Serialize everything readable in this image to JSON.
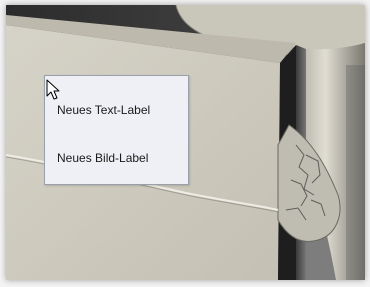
{
  "context_menu": {
    "items": [
      {
        "label": "Neues Text-Label"
      },
      {
        "label": "Neues Bild-Label"
      }
    ]
  },
  "icons": {
    "cursor": "arrow-cursor-icon"
  },
  "colors": {
    "menu_background": "#eef0f6",
    "menu_border": "#9aa0aa",
    "model_face": "#cfcbbf",
    "model_dark_edge": "#1f1f1f",
    "background": "#7f7f7f"
  }
}
